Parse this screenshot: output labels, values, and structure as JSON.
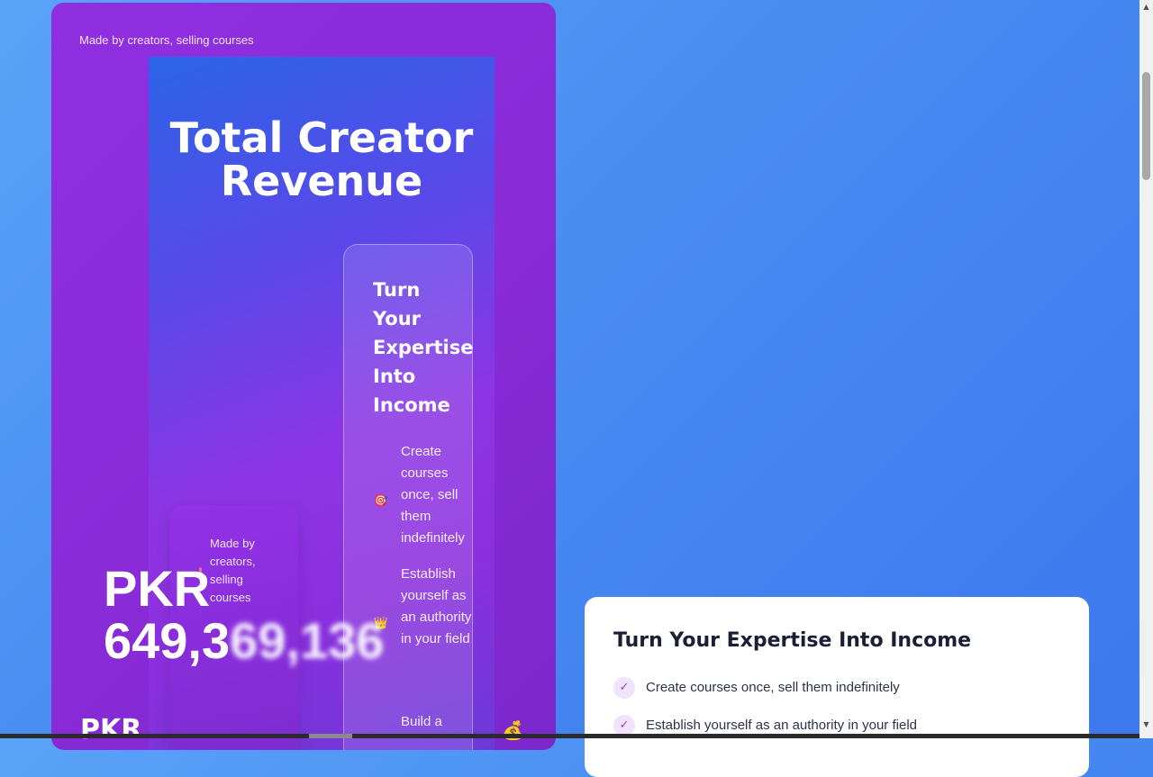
{
  "outer": {
    "tagline": "Made by creators, selling courses",
    "pkr_prefix": "PKR"
  },
  "revenue": {
    "title_line1": "Total Creator",
    "title_line2": "Revenue",
    "stats_tagline": "Made by creators, selling courses",
    "currency": "PKR",
    "amount_visible": "649,3",
    "amount_blurred": "69,136"
  },
  "benefits_card": {
    "title": "Turn Your Expertise Into Income",
    "items": [
      {
        "icon": "target-icon",
        "glyph": "🎯",
        "text": "Create courses once, sell them indefinitely"
      },
      {
        "icon": "crown-icon",
        "glyph": "👑",
        "text": "Establish yourself as an authority in your field"
      },
      {
        "icon": "",
        "glyph": "",
        "text": "Build a"
      }
    ],
    "money_glyph": "💰"
  },
  "expertise_panel": {
    "title": "Turn Your Expertise Into Income",
    "check_glyph": "✓",
    "items": [
      "Create courses once, sell them indefinitely",
      "Establish yourself as an authority in your field"
    ]
  },
  "scrollbar": {
    "up_glyph": "▲",
    "down_glyph": "▼"
  }
}
